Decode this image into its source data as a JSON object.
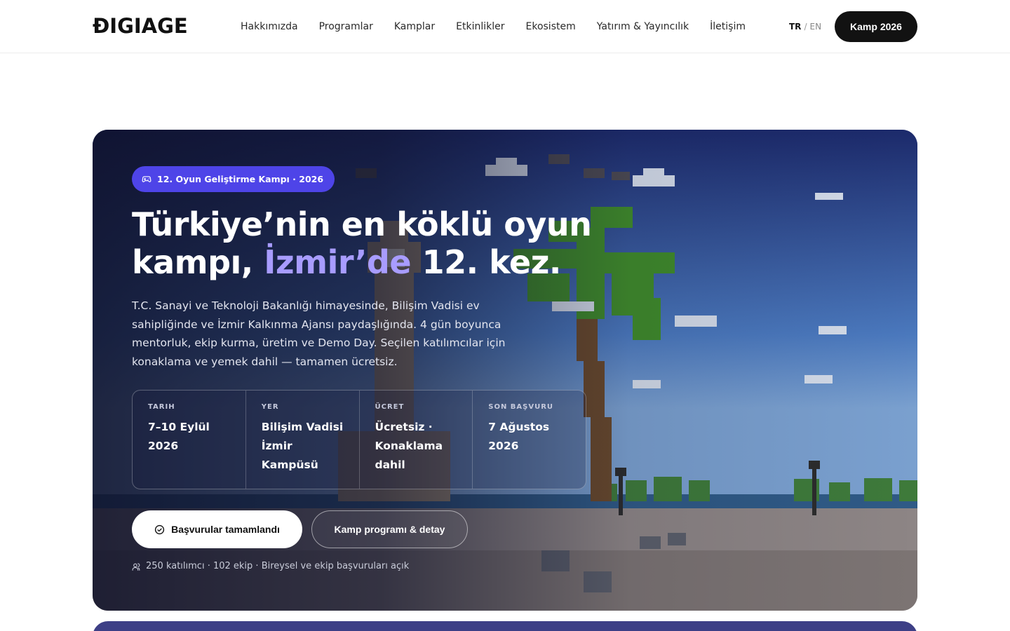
{
  "header": {
    "logo": "ÐIGIAGE",
    "nav": [
      "Hakkımızda",
      "Programlar",
      "Kamplar",
      "Etkinlikler",
      "Ekosistem",
      "Yatırım & Yayıncılık",
      "İletişim"
    ],
    "lang_active": "TR",
    "lang_sep": "/",
    "lang_other": "EN",
    "cta": "Kamp 2026"
  },
  "hero": {
    "badge": "12. Oyun Geliştirme Kampı · 2026",
    "title_part1": "Türkiye’nin en köklü oyun kampı, ",
    "title_highlight": "İzmir’de",
    "title_part2": " 12. kez.",
    "description": "T.C. Sanayi ve Teknoloji Bakanlığı himayesinde, Bilişim Vadisi ev sahipliğinde ve İzmir Kalkınma Ajansı paydaşlığında. 4 gün boyunca mentorluk, ekip kurma, üretim ve Demo Day. Seçilen katılımcılar için konaklama ve yemek dahil — tamamen ücretsiz.",
    "facts": [
      {
        "label": "Tarih",
        "value": "7–10 Eylül 2026"
      },
      {
        "label": "Yer",
        "value": "Bilişim Vadisi İzmir Kampüsü"
      },
      {
        "label": "Ücret",
        "value": "Ücretsiz · Konaklama dahil"
      },
      {
        "label": "Son başvuru",
        "value": "7 Ağustos 2026"
      }
    ],
    "btn_primary": "Başvurular tamamlandı",
    "btn_secondary": "Kamp programı & detay",
    "meta": "250 katılımcı · 102 ekip · Bireysel ve ekip başvuruları açık"
  },
  "colors": {
    "accent": "#4e44e8",
    "highlight": "#a89cff",
    "dark": "#121212"
  }
}
